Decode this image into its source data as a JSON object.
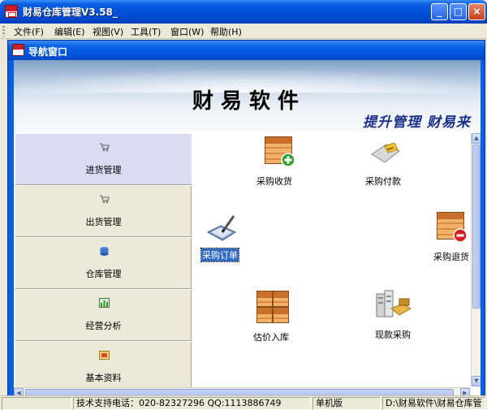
{
  "window": {
    "title": "财易仓库管理V3.58_",
    "minimize": "_",
    "maximize": "□",
    "close": "×"
  },
  "menu": [
    {
      "label": "文件(F)"
    },
    {
      "label": "编辑(E)"
    },
    {
      "label": "视图(V)"
    },
    {
      "label": "工具(T)"
    },
    {
      "label": "窗口(W)"
    },
    {
      "label": "帮助(H)"
    }
  ],
  "child_window": {
    "title": "导航窗口"
  },
  "banner": {
    "title": "财易软件",
    "slogan": "提升管理 财易来"
  },
  "nav_sections": [
    {
      "label": "进货管理",
      "icon": "cart-icon",
      "active": true
    },
    {
      "label": "出货管理",
      "icon": "cart-icon",
      "active": false
    },
    {
      "label": "仓库管理",
      "icon": "database-icon",
      "active": false
    },
    {
      "label": "经营分析",
      "icon": "chart-icon",
      "active": false
    },
    {
      "label": "基本资料",
      "icon": "folder-icon",
      "active": false
    }
  ],
  "icons": {
    "purchase_receipt": "采购收货",
    "purchase_payment": "采购付款",
    "purchase_order": "采购订单",
    "purchase_return": "采购退货",
    "estimate_stock_in": "估价入库",
    "cash_purchase": "现款采购"
  },
  "status": {
    "support": "技术支持电话：020-82327296 QQ:1113886749",
    "mode": "单机版",
    "path": "D:\\财易软件\\财易仓库管"
  }
}
